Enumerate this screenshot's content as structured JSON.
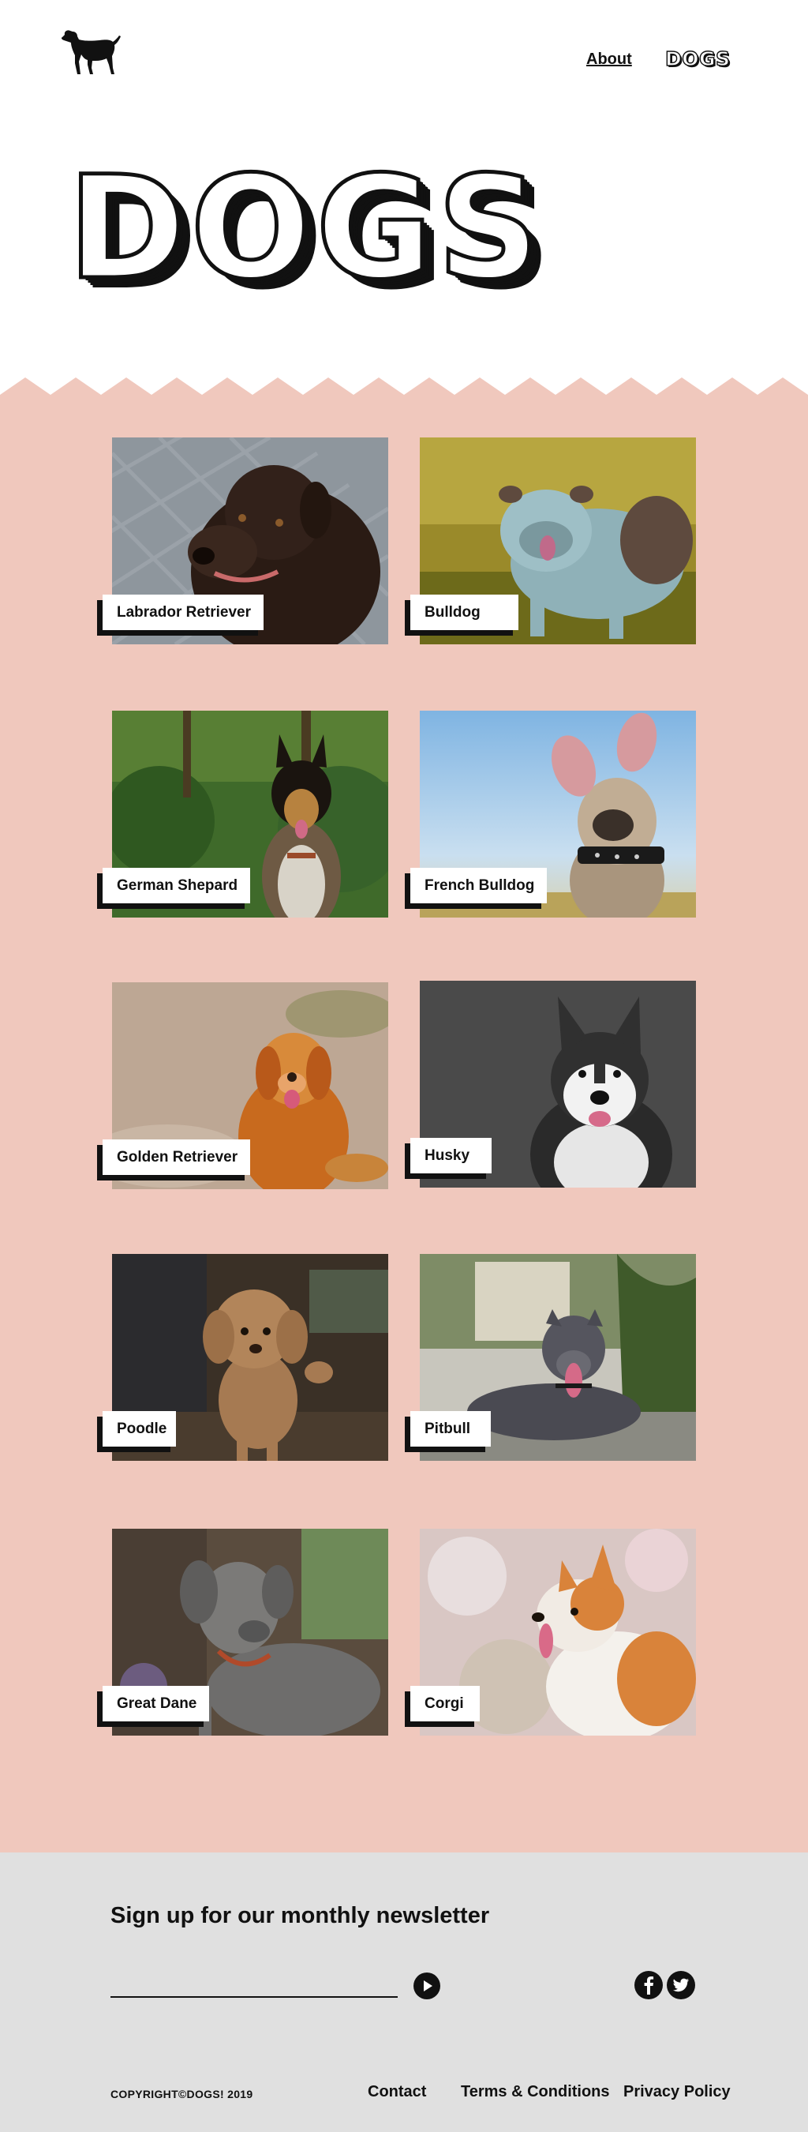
{
  "header": {
    "logo_icon": "dog-silhouette-icon",
    "nav": {
      "about_label": "About",
      "dogs_label": "DOGS"
    },
    "hero_title": "DOGS"
  },
  "colors": {
    "gallery_background": "#f0c8bd",
    "footer_background": "#e0e0e0",
    "text": "#111111"
  },
  "gallery": {
    "dogs": [
      {
        "name": "Labrador Retriever"
      },
      {
        "name": "Bulldog"
      },
      {
        "name": "German Shepard"
      },
      {
        "name": "French Bulldog"
      },
      {
        "name": "Golden Retriever"
      },
      {
        "name": "Husky"
      },
      {
        "name": "Poodle"
      },
      {
        "name": "Pitbull"
      },
      {
        "name": "Great Dane"
      },
      {
        "name": "Corgi"
      }
    ]
  },
  "footer": {
    "newsletter_title": "Sign up for our monthly newsletter",
    "email_placeholder": "",
    "submit_icon": "arrow-right-circle-icon",
    "social": [
      "facebook-icon",
      "twitter-icon"
    ],
    "copyright": "COPYRIGHT©DOGS! 2019",
    "links": {
      "contact": "Contact",
      "terms": "Terms & Conditions",
      "privacy": "Privacy Policy"
    }
  }
}
